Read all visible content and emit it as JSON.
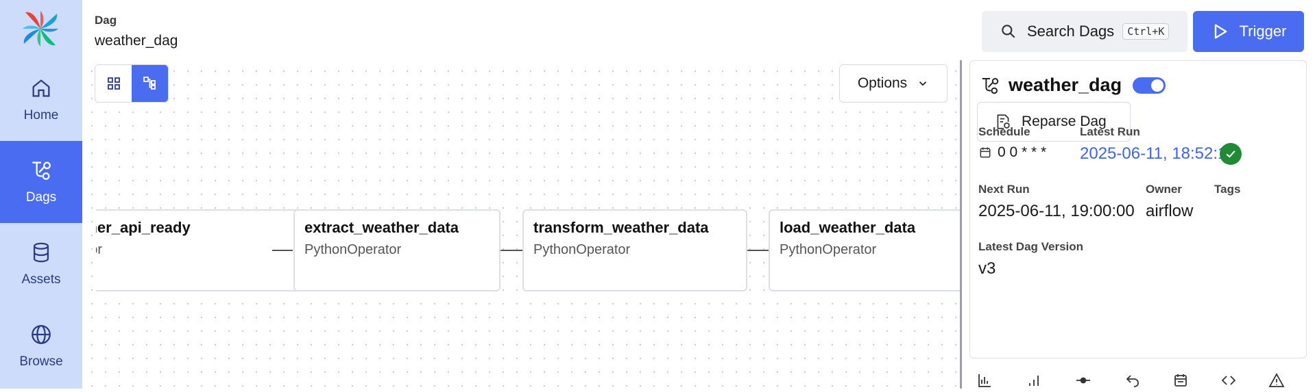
{
  "nav": {
    "items": [
      {
        "label": "Home",
        "icon": "home-icon"
      },
      {
        "label": "Dags",
        "icon": "dags-icon",
        "active": true
      },
      {
        "label": "Assets",
        "icon": "assets-icon"
      },
      {
        "label": "Browse",
        "icon": "globe-icon"
      }
    ]
  },
  "header": {
    "breadcrumb_label": "Dag",
    "dag_title": "weather_dag",
    "search_label": "Search Dags",
    "search_shortcut": "Ctrl+K",
    "trigger_label": "Trigger"
  },
  "graph": {
    "options_label": "Options",
    "nodes": [
      {
        "title": "is_weather_api_ready",
        "operator": "HttpSensor"
      },
      {
        "title": "extract_weather_data",
        "operator": "PythonOperator"
      },
      {
        "title": "transform_weather_data",
        "operator": "PythonOperator"
      },
      {
        "title": "load_weather_data",
        "operator": "PythonOperator"
      }
    ]
  },
  "details": {
    "dag_name": "weather_dag",
    "paused": false,
    "reparse_label": "Reparse Dag",
    "schedule_label": "Schedule",
    "schedule_value": "0 0 * * *",
    "latest_run_label": "Latest Run",
    "latest_run_value": "2025-06-11, 18:52:17",
    "latest_run_state": "success",
    "next_run_label": "Next Run",
    "next_run_value": "2025-06-11, 19:00:00",
    "owner_label": "Owner",
    "owner_value": "airflow",
    "tags_label": "Tags",
    "dag_version_label": "Latest Dag Version",
    "dag_version_value": "v3"
  },
  "colors": {
    "accent": "#4a6cf0",
    "nav_bg": "#cddcfb",
    "success": "#208a36",
    "link": "#3f63e6"
  },
  "bottom_tabs": [
    "bar-chart-icon",
    "signal-icon",
    "commit-icon",
    "undo-icon",
    "calendar-icon",
    "code-icon",
    "warning-icon"
  ]
}
